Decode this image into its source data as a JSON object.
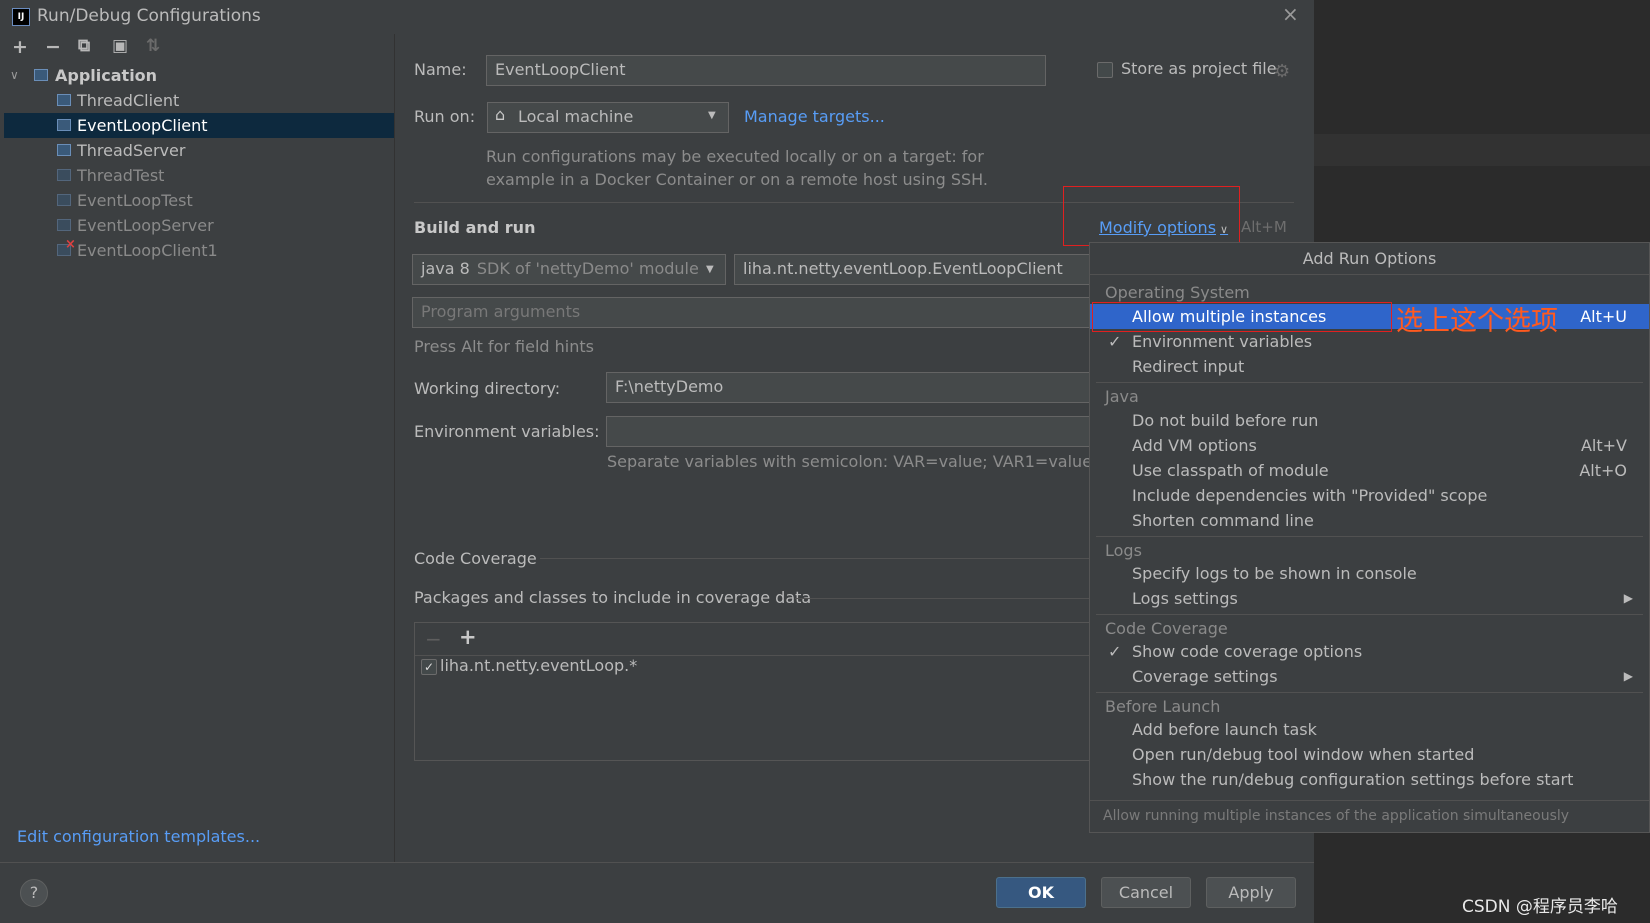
{
  "window": {
    "title": "Run/Debug Configurations"
  },
  "toolbar": [
    "+",
    "−",
    "⧉",
    "▣",
    "⇅"
  ],
  "tree": {
    "root": "Application",
    "items": [
      "ThreadClient",
      "EventLoopClient",
      "ThreadServer",
      "ThreadTest",
      "EventLoopTest",
      "EventLoopServer",
      "EventLoopClient1"
    ],
    "selected": "EventLoopClient"
  },
  "edit_templates_link": "Edit configuration templates...",
  "form": {
    "name_label": "Name:",
    "name_value": "EventLoopClient",
    "store_label": "Store as project file",
    "run_on_label": "Run on:",
    "run_on_value": "Local machine",
    "manage_targets": "Manage targets...",
    "run_on_hint_1": "Run configurations may be executed locally or on a target: for",
    "run_on_hint_2": "example in a Docker Container or on a remote host using SSH.",
    "build_run_label": "Build and run",
    "modify_options": "Modify options",
    "modify_shortcut": "Alt+M",
    "jdk_main": "java 8",
    "jdk_sub": "SDK of 'nettyDemo' module",
    "main_class": "liha.nt.netty.eventLoop.EventLoopClient",
    "program_args_placeholder": "Program arguments",
    "alt_hint": "Press Alt for field hints",
    "working_dir_label": "Working directory:",
    "working_dir_value": "F:\\nettyDemo",
    "env_label": "Environment variables:",
    "env_hint": "Separate variables with semicolon: VAR=value; VAR1=value1",
    "coverage_label": "Code Coverage",
    "packages_label": "Packages and classes to include in coverage data",
    "coverage_entry": "liha.nt.netty.eventLoop.*"
  },
  "buttons": {
    "ok": "OK",
    "cancel": "Cancel",
    "apply": "Apply",
    "help": "?"
  },
  "popup": {
    "title": "Add Run Options",
    "sections": [
      {
        "head": "Operating System",
        "items": [
          {
            "label": "Allow multiple instances",
            "shortcut": "Alt+U",
            "highlight": true
          },
          {
            "label": "Environment variables",
            "checked": true
          },
          {
            "label": "Redirect input"
          }
        ]
      },
      {
        "head": "Java",
        "items": [
          {
            "label": "Do not build before run"
          },
          {
            "label": "Add VM options",
            "shortcut": "Alt+V"
          },
          {
            "label": "Use classpath of module",
            "shortcut": "Alt+O"
          },
          {
            "label": "Include dependencies with \"Provided\" scope"
          },
          {
            "label": "Shorten command line"
          }
        ]
      },
      {
        "head": "Logs",
        "items": [
          {
            "label": "Specify logs to be shown in console"
          },
          {
            "label": "Logs settings",
            "submenu": true
          }
        ]
      },
      {
        "head": "Code Coverage",
        "items": [
          {
            "label": "Show code coverage options",
            "checked": true
          },
          {
            "label": "Coverage settings",
            "submenu": true
          }
        ]
      },
      {
        "head": "Before Launch",
        "items": [
          {
            "label": "Add before launch task"
          },
          {
            "label": "Open run/debug tool window when started"
          },
          {
            "label": "Show the run/debug configuration settings before start"
          }
        ]
      }
    ],
    "footer": "Allow running multiple instances of the application simultaneously"
  },
  "annotation": "选上这个选项",
  "watermark": "CSDN @程序员李哈"
}
